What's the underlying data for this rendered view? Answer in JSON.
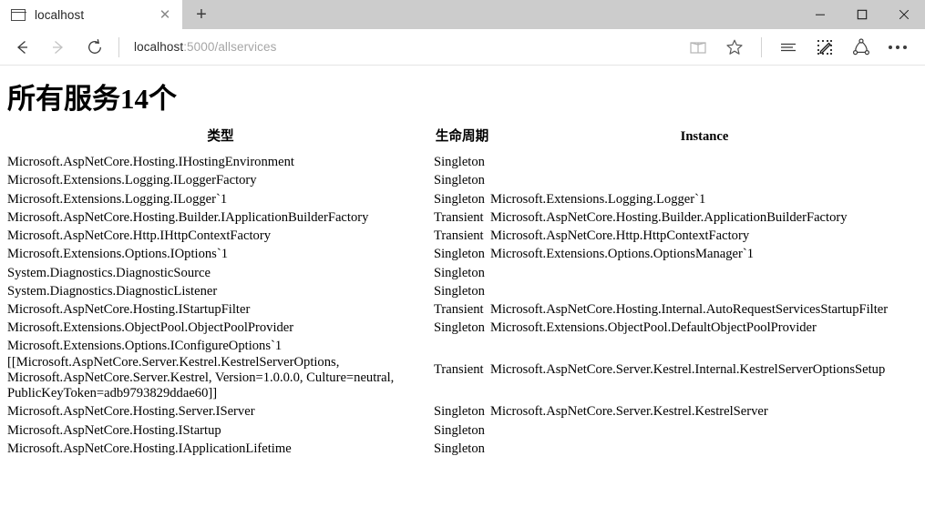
{
  "window": {
    "minimize_label": "minimize",
    "maximize_label": "maximize",
    "close_label": "close"
  },
  "tabstrip": {
    "tab_title": "localhost",
    "close_glyph": "✕",
    "new_tab_glyph": "+"
  },
  "navbar": {
    "back_label": "Back",
    "forward_label": "Forward",
    "refresh_label": "Refresh",
    "url_host": "localhost",
    "url_path": ":5000/allservices",
    "reading_view_label": "Reading view",
    "favorites_label": "Add to favorites",
    "hub_label": "Hub",
    "web_note_label": "Make a Web Note",
    "share_label": "Share",
    "more_label": "More"
  },
  "page": {
    "title": "所有服务14个",
    "columns": {
      "type": "类型",
      "lifetime": "生命周期",
      "instance": "Instance"
    },
    "rows": [
      {
        "type": "Microsoft.AspNetCore.Hosting.IHostingEnvironment",
        "lifetime": "Singleton",
        "instance": ""
      },
      {
        "type": "Microsoft.Extensions.Logging.ILoggerFactory",
        "lifetime": "Singleton",
        "instance": ""
      },
      {
        "type": "Microsoft.Extensions.Logging.ILogger`1",
        "lifetime": "Singleton",
        "instance": "Microsoft.Extensions.Logging.Logger`1"
      },
      {
        "type": "Microsoft.AspNetCore.Hosting.Builder.IApplicationBuilderFactory",
        "lifetime": "Transient",
        "instance": "Microsoft.AspNetCore.Hosting.Builder.ApplicationBuilderFactory"
      },
      {
        "type": "Microsoft.AspNetCore.Http.IHttpContextFactory",
        "lifetime": "Transient",
        "instance": "Microsoft.AspNetCore.Http.HttpContextFactory"
      },
      {
        "type": "Microsoft.Extensions.Options.IOptions`1",
        "lifetime": "Singleton",
        "instance": "Microsoft.Extensions.Options.OptionsManager`1"
      },
      {
        "type": "System.Diagnostics.DiagnosticSource",
        "lifetime": "Singleton",
        "instance": ""
      },
      {
        "type": "System.Diagnostics.DiagnosticListener",
        "lifetime": "Singleton",
        "instance": ""
      },
      {
        "type": "Microsoft.AspNetCore.Hosting.IStartupFilter",
        "lifetime": "Transient",
        "instance": "Microsoft.AspNetCore.Hosting.Internal.AutoRequestServicesStartupFilter"
      },
      {
        "type": "Microsoft.Extensions.ObjectPool.ObjectPoolProvider",
        "lifetime": "Singleton",
        "instance": "Microsoft.Extensions.ObjectPool.DefaultObjectPoolProvider"
      },
      {
        "type": "Microsoft.Extensions.Options.IConfigureOptions`1 [[Microsoft.AspNetCore.Server.Kestrel.KestrelServerOptions, Microsoft.AspNetCore.Server.Kestrel, Version=1.0.0.0, Culture=neutral, PublicKeyToken=adb9793829ddae60]]",
        "lifetime": "Transient",
        "instance": "Microsoft.AspNetCore.Server.Kestrel.Internal.KestrelServerOptionsSetup"
      },
      {
        "type": "Microsoft.AspNetCore.Hosting.Server.IServer",
        "lifetime": "Singleton",
        "instance": "Microsoft.AspNetCore.Server.Kestrel.KestrelServer"
      },
      {
        "type": "Microsoft.AspNetCore.Hosting.IStartup",
        "lifetime": "Singleton",
        "instance": ""
      },
      {
        "type": "Microsoft.AspNetCore.Hosting.IApplicationLifetime",
        "lifetime": "Singleton",
        "instance": ""
      }
    ]
  },
  "colors": {
    "tabstrip_bg": "#cccccc",
    "tab_active_bg": "#ffffff",
    "chrome_bg": "#ffffff",
    "text": "#000000",
    "url_host": "#2b2b2b",
    "url_path": "#a6a6a6"
  }
}
